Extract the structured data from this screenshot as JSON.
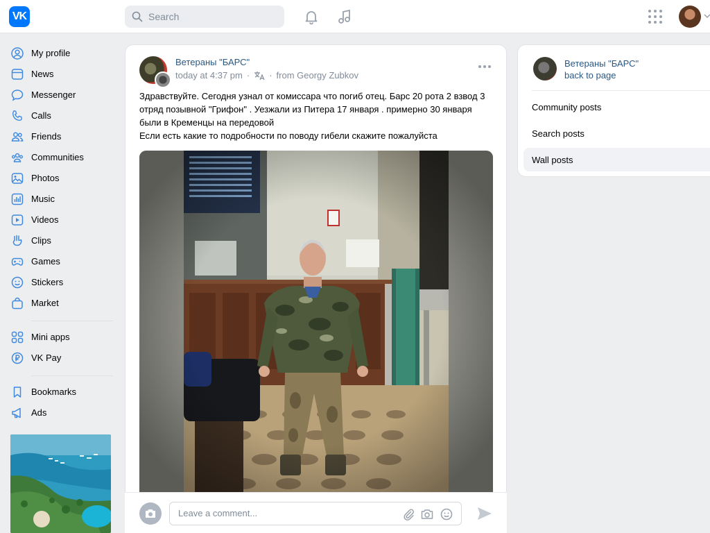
{
  "topbar": {
    "logo_text": "VK",
    "search_placeholder": "Search"
  },
  "sidebar": {
    "items": [
      {
        "label": "My profile",
        "icon": "user-circle-icon"
      },
      {
        "label": "News",
        "icon": "news-icon"
      },
      {
        "label": "Messenger",
        "icon": "chat-bubble-icon"
      },
      {
        "label": "Calls",
        "icon": "phone-icon"
      },
      {
        "label": "Friends",
        "icon": "friends-icon"
      },
      {
        "label": "Communities",
        "icon": "communities-icon"
      },
      {
        "label": "Photos",
        "icon": "photo-icon"
      },
      {
        "label": "Music",
        "icon": "music-icon"
      },
      {
        "label": "Videos",
        "icon": "video-icon"
      },
      {
        "label": "Clips",
        "icon": "clips-icon"
      },
      {
        "label": "Games",
        "icon": "gamepad-icon"
      },
      {
        "label": "Stickers",
        "icon": "smile-icon"
      },
      {
        "label": "Market",
        "icon": "bag-icon"
      },
      {
        "label": "Mini apps",
        "icon": "grid-icon"
      },
      {
        "label": "VK Pay",
        "icon": "ruble-icon"
      },
      {
        "label": "Bookmarks",
        "icon": "bookmark-icon"
      },
      {
        "label": "Ads",
        "icon": "megaphone-icon"
      }
    ]
  },
  "post": {
    "author": "Ветераны \"БАРС\"",
    "time": "today at 4:37 pm",
    "dot1": "·",
    "dot2": "·",
    "from": "from Georgy Zubkov",
    "text_lines": [
      "Здравствуйте. Сегодня узнал от комиссара что погиб отец. Барс 20 рота 2 взвод 3 отряд позывной \"Грифон\" . Уезжали из Питера 17 января . примерно 30 января были в Кременцы на передовой",
      "Если есть какие то подробности по поводу гибели скажите пожалуйста"
    ]
  },
  "comment": {
    "placeholder": "Leave a comment..."
  },
  "right_panel": {
    "title": "Ветераны \"БАРС\"",
    "back": "back to page",
    "items": [
      "Community posts",
      "Search posts",
      "Wall posts"
    ],
    "active_index": 2
  },
  "colors": {
    "accent": "#0077ff",
    "link": "#2a5885",
    "icon": "#3f8ae0",
    "background": "#edeef0"
  }
}
